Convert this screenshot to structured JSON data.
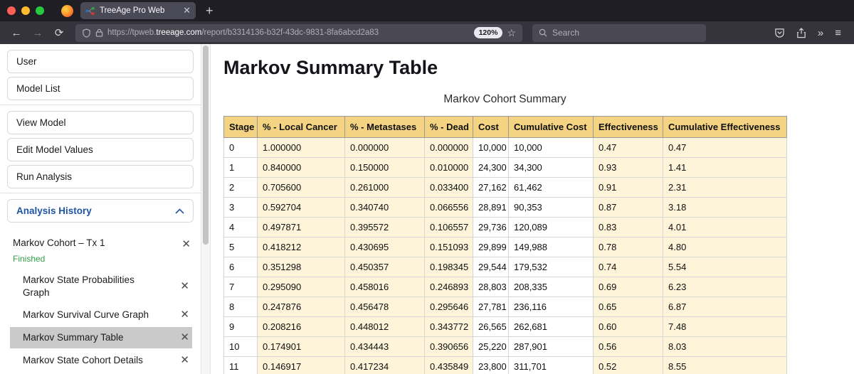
{
  "browser": {
    "tab_title": "TreeAge Pro Web",
    "url_scheme": "https://tpweb.",
    "url_domain": "treeage.com",
    "url_path": "/report/b3314136-b32f-43dc-9831-8fa6abcd2a83",
    "zoom_level": "120%",
    "search_placeholder": "Search"
  },
  "icons": {
    "back": "←",
    "forward": "→",
    "reload": "⟳",
    "star": "☆",
    "plus": "+",
    "close": "✕",
    "chevrons": "»",
    "menu": "≡"
  },
  "colors": {
    "accent_blue": "#1f55a4",
    "finished_green": "#2f9e44",
    "table_header_bg": "#f4d483",
    "table_tint_bg": "#fdf4da",
    "selected_item_bg": "#cacaca"
  },
  "sidebar": {
    "items": [
      "User",
      "Model List",
      "View Model",
      "Edit Model Values",
      "Run Analysis"
    ],
    "analysis_history_label": "Analysis History",
    "history": {
      "root_label": "Markov Cohort – Tx 1",
      "root_status": "Finished",
      "children": [
        "Markov State Probabilities Graph",
        "Markov Survival Curve Graph",
        "Markov Summary Table",
        "Markov State Cohort Details"
      ],
      "selected": "Markov Summary Table"
    }
  },
  "main": {
    "title": "Markov Summary Table",
    "table_title": "Markov Cohort Summary",
    "table": {
      "columns": [
        "Stage",
        "% - Local Cancer",
        "% - Metastases",
        "% - Dead",
        "Cost",
        "Cumulative Cost",
        "Effectiveness",
        "Cumulative Effectiveness"
      ],
      "rows": [
        [
          "0",
          "1.000000",
          "0.000000",
          "0.000000",
          "10,000",
          "10,000",
          "0.47",
          "0.47"
        ],
        [
          "1",
          "0.840000",
          "0.150000",
          "0.010000",
          "24,300",
          "34,300",
          "0.93",
          "1.41"
        ],
        [
          "2",
          "0.705600",
          "0.261000",
          "0.033400",
          "27,162",
          "61,462",
          "0.91",
          "2.31"
        ],
        [
          "3",
          "0.592704",
          "0.340740",
          "0.066556",
          "28,891",
          "90,353",
          "0.87",
          "3.18"
        ],
        [
          "4",
          "0.497871",
          "0.395572",
          "0.106557",
          "29,736",
          "120,089",
          "0.83",
          "4.01"
        ],
        [
          "5",
          "0.418212",
          "0.430695",
          "0.151093",
          "29,899",
          "149,988",
          "0.78",
          "4.80"
        ],
        [
          "6",
          "0.351298",
          "0.450357",
          "0.198345",
          "29,544",
          "179,532",
          "0.74",
          "5.54"
        ],
        [
          "7",
          "0.295090",
          "0.458016",
          "0.246893",
          "28,803",
          "208,335",
          "0.69",
          "6.23"
        ],
        [
          "8",
          "0.247876",
          "0.456478",
          "0.295646",
          "27,781",
          "236,116",
          "0.65",
          "6.87"
        ],
        [
          "9",
          "0.208216",
          "0.448012",
          "0.343772",
          "26,565",
          "262,681",
          "0.60",
          "7.48"
        ],
        [
          "10",
          "0.174901",
          "0.434443",
          "0.390656",
          "25,220",
          "287,901",
          "0.56",
          "8.03"
        ],
        [
          "11",
          "0.146917",
          "0.417234",
          "0.435849",
          "23,800",
          "311,701",
          "0.52",
          "8.55"
        ]
      ]
    }
  }
}
